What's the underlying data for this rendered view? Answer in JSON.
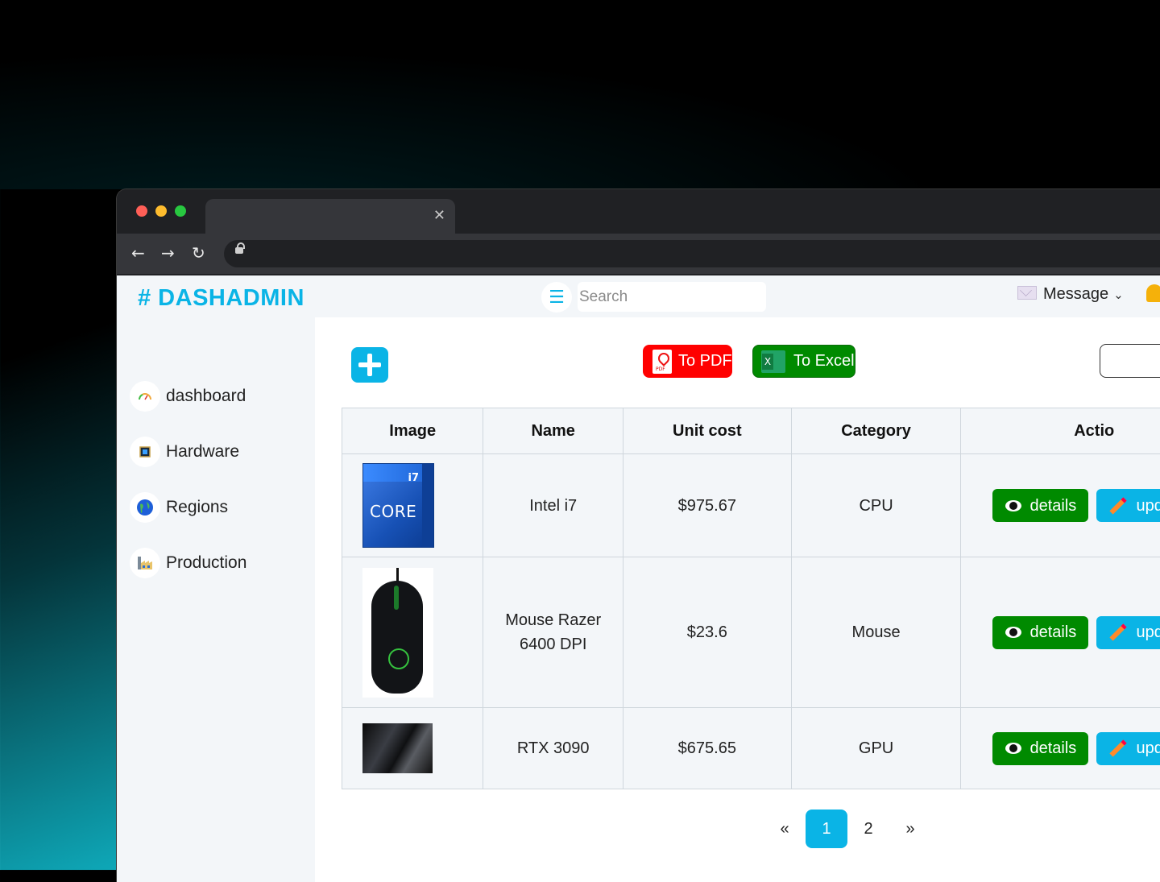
{
  "brand": "# DASHADMIN",
  "search": {
    "placeholder": "Search"
  },
  "header": {
    "message_label": "Message"
  },
  "sidebar": {
    "items": [
      {
        "label": "dashboard"
      },
      {
        "label": "Hardware"
      },
      {
        "label": "Regions"
      },
      {
        "label": "Production"
      }
    ]
  },
  "toolbar": {
    "pdf_label": "To PDF",
    "excel_label": "To Excel"
  },
  "table": {
    "headers": [
      "Image",
      "Name",
      "Unit cost",
      "Category",
      "Actio"
    ],
    "rows": [
      {
        "name": "Intel i7",
        "unit_cost": "$975.67",
        "category": "CPU",
        "details_label": "details",
        "update_label": "upd"
      },
      {
        "name": "Mouse Razer 6400 DPI",
        "unit_cost": "$23.6",
        "category": "Mouse",
        "details_label": "details",
        "update_label": "upd"
      },
      {
        "name": "RTX 3090",
        "unit_cost": "$675.65",
        "category": "GPU",
        "details_label": "details",
        "update_label": "upd"
      }
    ]
  },
  "pagination": {
    "prev": "«",
    "pages": [
      "1",
      "2"
    ],
    "next": "»",
    "active_page": "1"
  },
  "colors": {
    "accent": "#0ab4e6",
    "pdf": "#ff0000",
    "excel": "#008a00",
    "details": "#008a00"
  }
}
